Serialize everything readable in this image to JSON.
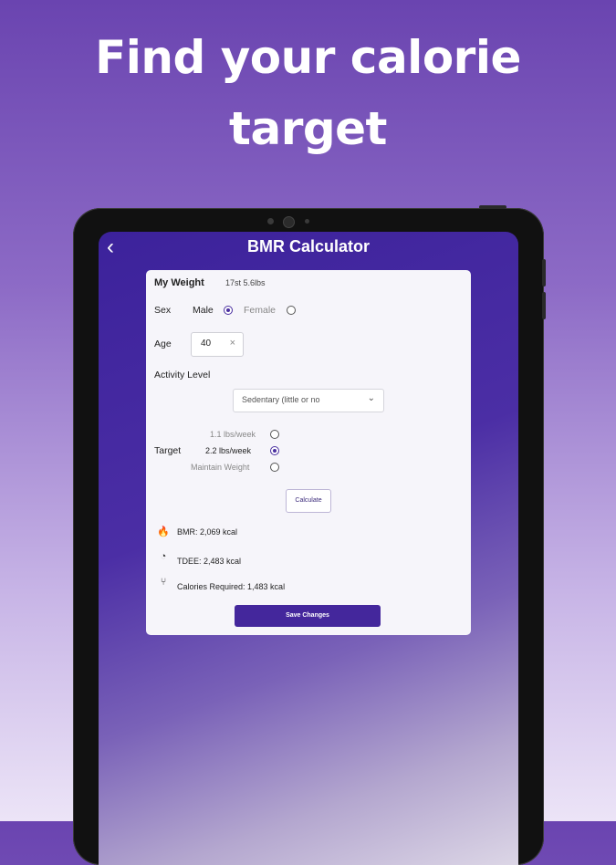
{
  "headline": {
    "line1": "Find your calorie",
    "line2": "target"
  },
  "appbar": {
    "back_icon": "‹",
    "title": "BMR Calculator"
  },
  "form": {
    "weight": {
      "label": "My Weight",
      "value": "17st 5.6lbs"
    },
    "sex": {
      "label": "Sex",
      "options": [
        {
          "label": "Male",
          "selected": true
        },
        {
          "label": "Female",
          "selected": false
        }
      ]
    },
    "age": {
      "label": "Age",
      "value": "40",
      "clear_icon": "×"
    },
    "activity": {
      "label": "Activity Level",
      "selected": "Sedentary (little or no",
      "chevron_icon": "⌄"
    },
    "target": {
      "label": "Target",
      "options": [
        {
          "label": "1.1 lbs/week",
          "selected": false
        },
        {
          "label": "2.2 lbs/week",
          "selected": true
        },
        {
          "label": "Maintain Weight",
          "selected": false
        }
      ]
    },
    "calculate_label": "Calculate"
  },
  "results": {
    "bmr": {
      "icon": "flame-icon",
      "glyph": "🔥",
      "text": "BMR: 2,069 kcal"
    },
    "tdee": {
      "icon": "gauge-icon",
      "glyph": "◔",
      "text": "TDEE: 2,483 kcal"
    },
    "calories": {
      "icon": "utensils-icon",
      "glyph": "⑂",
      "text": "Calories Required: 1,483 kcal"
    }
  },
  "save_label": "Save Changes",
  "colors": {
    "accent": "#44279c",
    "card": "#f6f5fa",
    "header_bg": "#3c229b"
  }
}
